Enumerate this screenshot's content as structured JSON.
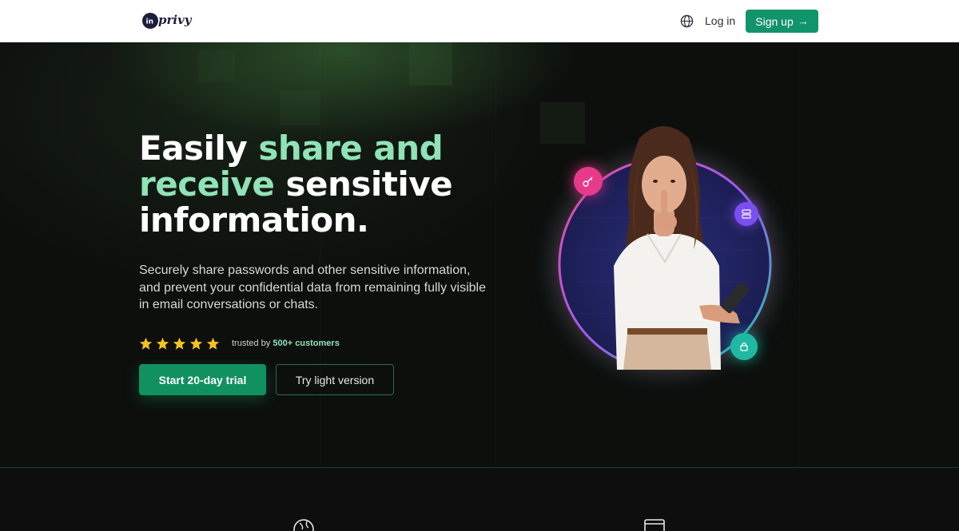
{
  "header": {
    "logo_text": "inprivy",
    "login_label": "Log in",
    "signup_label": "Sign up",
    "signup_icon": "arrow-right-icon",
    "language_icon": "globe-icon"
  },
  "hero": {
    "title_part1": "Easily ",
    "title_accent1": "share and",
    "title_accent2": "receive",
    "title_part2": " sensitive",
    "title_part3": "information.",
    "description": "Securely share passwords and other sensitive information, and prevent your confidential data from remaining fully visible in email conversations or chats.",
    "rating": 5,
    "trusted_prefix": "trusted by ",
    "trusted_count": "500+ customers",
    "primary_button": "Start 20-day trial",
    "secondary_button": "Try light version"
  },
  "colors": {
    "brand_green": "#12946a",
    "accent_mint": "#8fe3b6",
    "star_yellow": "#f5c21b",
    "badge_pink": "#e83a8c",
    "badge_purple": "#7b4ef0",
    "badge_teal": "#1fb8a2"
  },
  "illustration": {
    "badges": [
      "key-icon",
      "list-icon",
      "lock-icon"
    ]
  },
  "features": {
    "icons": [
      "globe-refresh-icon",
      "browser-window-icon"
    ]
  }
}
